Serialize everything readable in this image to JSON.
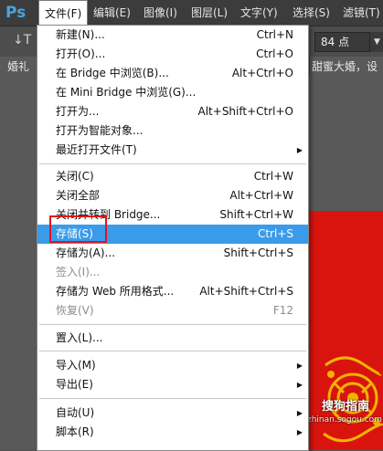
{
  "app": {
    "logo": "Ps"
  },
  "menubar": [
    {
      "label": "文件(F)",
      "active": true
    },
    {
      "label": "编辑(E)"
    },
    {
      "label": "图像(I)"
    },
    {
      "label": "图层(L)"
    },
    {
      "label": "文字(Y)"
    },
    {
      "label": "选择(S)"
    },
    {
      "label": "滤镜(T)"
    }
  ],
  "options_bar": {
    "tool_glyph": "↓T",
    "font_size": "84 点"
  },
  "doc_tabs": {
    "left": "婚礼",
    "right": "甜蜜大婚，设"
  },
  "file_menu": {
    "items": [
      {
        "label": "新建(N)...",
        "shortcut": "Ctrl+N"
      },
      {
        "label": "打开(O)...",
        "shortcut": "Ctrl+O"
      },
      {
        "label": "在 Bridge 中浏览(B)...",
        "shortcut": "Alt+Ctrl+O"
      },
      {
        "label": "在 Mini Bridge 中浏览(G)...",
        "shortcut": ""
      },
      {
        "label": "打开为...",
        "shortcut": "Alt+Shift+Ctrl+O"
      },
      {
        "label": "打开为智能对象...",
        "shortcut": ""
      },
      {
        "label": "最近打开文件(T)",
        "shortcut": "",
        "submenu": true
      },
      {
        "label": "关闭(C)",
        "shortcut": "Ctrl+W"
      },
      {
        "label": "关闭全部",
        "shortcut": "Alt+Ctrl+W"
      },
      {
        "label": "关闭并转到 Bridge...",
        "shortcut": "Shift+Ctrl+W"
      },
      {
        "label": "存储(S)",
        "shortcut": "Ctrl+S",
        "highlighted": true
      },
      {
        "label": "存储为(A)...",
        "shortcut": "Shift+Ctrl+S"
      },
      {
        "label": "签入(I)...",
        "shortcut": "",
        "disabled": true
      },
      {
        "label": "存储为 Web 所用格式...",
        "shortcut": "Alt+Shift+Ctrl+S"
      },
      {
        "label": "恢复(V)",
        "shortcut": "F12",
        "disabled": true
      },
      {
        "label": "置入(L)...",
        "shortcut": ""
      },
      {
        "label": "导入(M)",
        "shortcut": "",
        "submenu": true
      },
      {
        "label": "导出(E)",
        "shortcut": "",
        "submenu": true
      },
      {
        "label": "自动(U)",
        "shortcut": "",
        "submenu": true
      },
      {
        "label": "脚本(R)",
        "shortcut": "",
        "submenu": true
      }
    ]
  },
  "watermark": {
    "text": "搜狗指南",
    "url": "zhinan.sogou.com"
  },
  "colors": {
    "highlight": "#3a9bea",
    "annotation": "#e0141a",
    "canvas": "#d9140e",
    "ornament": "#f2b400"
  }
}
